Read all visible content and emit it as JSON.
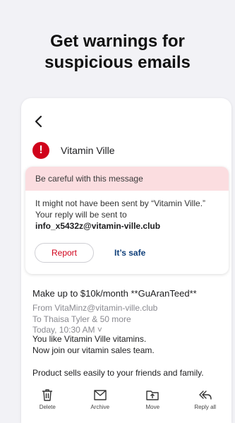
{
  "headline": {
    "line1": "Get warnings for",
    "line2": "suspicious emails"
  },
  "message": {
    "sender": "Vitamin Ville"
  },
  "warning": {
    "title": "Be careful with this message",
    "text1": "It might not have been sent by “Vitamin Ville.”",
    "text2": "Your reply will be sent to",
    "address": "info_x5432z@vitamin-ville.club",
    "report_label": "Report",
    "safe_label": "It’s safe"
  },
  "email": {
    "subject": "Make up to $10k/month **GuAranTeed**",
    "from": "From VitaMinz@vitamin-ville.club",
    "to": "To Thaisa Tyler & 50 more",
    "time": "Today, 10:30 AM ˅",
    "body1": "You like Vitamin Ville vitamins.",
    "body2": "Now join our vitamin sales team.",
    "body3": "Product sells easily to your friends and family."
  },
  "toolbar": {
    "delete": "Delete",
    "archive": "Archive",
    "move": "Move",
    "reply_all": "Reply all"
  },
  "colors": {
    "alert": "#d0021b",
    "warning_bg": "#fbdde0",
    "safe": "#0f3f7a",
    "page_bg": "#f2f2f6"
  }
}
